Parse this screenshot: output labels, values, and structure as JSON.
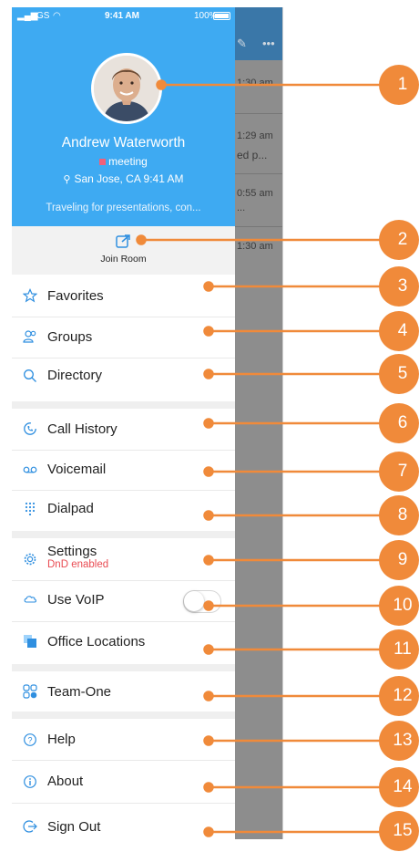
{
  "status_bar": {
    "carrier": "GS",
    "time": "9:41 AM",
    "battery": "100%"
  },
  "background_app": {
    "times": [
      "1:30 am",
      "1:29 am",
      "ed p...",
      "0:55 am",
      "...",
      "1:30 am"
    ]
  },
  "profile": {
    "name": "Andrew Waterworth",
    "presence": "meeting",
    "location": "San Jose, CA 9:41 AM",
    "status_message": "Traveling for presentations, con..."
  },
  "join_room": {
    "label": "Join Room"
  },
  "menu": {
    "favorites": "Favorites",
    "groups": "Groups",
    "directory": "Directory",
    "call_history": "Call History",
    "voicemail": "Voicemail",
    "dialpad": "Dialpad",
    "settings": "Settings",
    "settings_sub": "DnD enabled",
    "use_voip": "Use VoIP",
    "office_locations": "Office Locations",
    "team_one": "Team-One",
    "help": "Help",
    "about": "About",
    "sign_out": "Sign Out"
  },
  "use_voip_enabled": false,
  "callouts": [
    "1",
    "2",
    "3",
    "4",
    "5",
    "6",
    "7",
    "8",
    "9",
    "10",
    "11",
    "12",
    "13",
    "14",
    "15"
  ],
  "colors": {
    "header_blue": "#3eaaf2",
    "icon_blue": "#2f8fe0",
    "callout_orange": "#f08a3a",
    "warning_red": "#e94b52"
  }
}
